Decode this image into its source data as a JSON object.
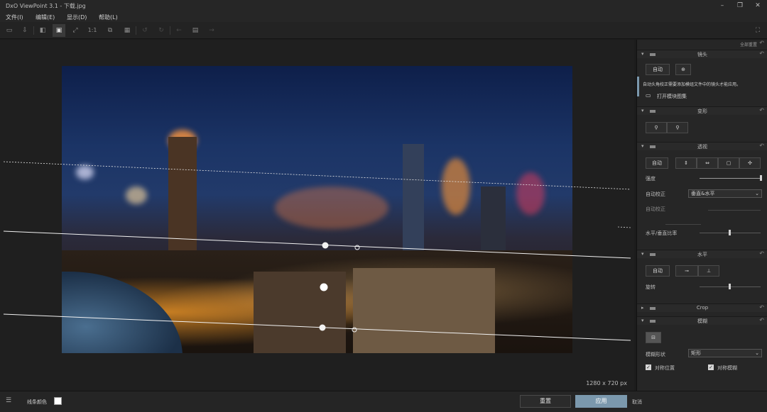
{
  "window": {
    "title": "DxO ViewPoint 3.1 - 下载.jpg"
  },
  "menu": [
    "文件(I)",
    "编辑(E)",
    "显示(D)",
    "帮助(L)"
  ],
  "image_info": {
    "dimensions": "1280 x 720 px"
  },
  "panel": {
    "top_reset_label": "全部重置",
    "lens": {
      "title": "镜头",
      "auto_label": "自动",
      "hint": "自动头角校正需要添加模组文件中的镜头才能应用。",
      "open_folder": "打开模块图集"
    },
    "distortion": {
      "title": "变形"
    },
    "perspective": {
      "title": "透视",
      "auto_label": "自动",
      "intensity_label": "强度",
      "auto_correct_label": "自动校正",
      "auto_correct_value": "垂直&水平",
      "auto_correct2_label": "自动校正",
      "ratio_label": "水平/垂直比率"
    },
    "horizon": {
      "title": "水平",
      "auto_label": "自动",
      "rotate_label": "旋转"
    },
    "crop": {
      "title": "Crop"
    },
    "blur": {
      "title": "模糊",
      "shape_label": "模糊形状",
      "shape_value": "矩形",
      "sym_pos_label": "对称位置",
      "sym_blur_label": "对称模糊"
    }
  },
  "bottom": {
    "line_color_label": "线条颜色",
    "reset_label": "重置",
    "apply_label": "应用",
    "cancel_label": "取消"
  }
}
